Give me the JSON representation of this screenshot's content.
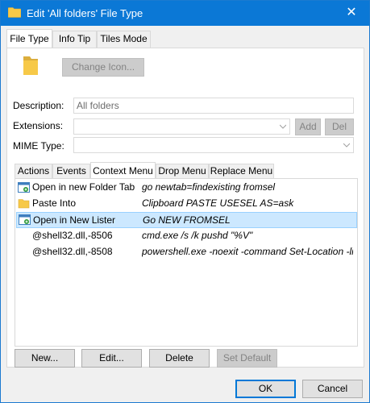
{
  "window": {
    "title": "Edit 'All folders' File Type",
    "close_glyph": "✕"
  },
  "tabs": [
    {
      "label": "File Type",
      "active": true
    },
    {
      "label": "Info Tip",
      "active": false
    },
    {
      "label": "Tiles Mode",
      "active": false
    }
  ],
  "file_type": {
    "change_icon_label": "Change Icon...",
    "description_label": "Description:",
    "description_value": "All folders",
    "extensions_label": "Extensions:",
    "extensions_value": "",
    "add_label": "Add",
    "del_label": "Del",
    "mime_label": "MIME Type:",
    "mime_value": ""
  },
  "inner_tabs": [
    {
      "label": "Actions",
      "active": false
    },
    {
      "label": "Events",
      "active": false
    },
    {
      "label": "Context Menu",
      "active": true
    },
    {
      "label": "Drop Menu",
      "active": false
    },
    {
      "label": "Replace Menu",
      "active": false
    }
  ],
  "context_menu_rows": [
    {
      "name": "Open in new Folder Tab",
      "command": "go newtab=findexisting fromsel",
      "icon": "folder-tab-icon",
      "selected": false
    },
    {
      "name": "Paste Into",
      "command": "Clipboard PASTE USESEL AS=ask",
      "icon": "folder-icon",
      "selected": false
    },
    {
      "name": "Open in New Lister",
      "command": "Go NEW FROMSEL",
      "icon": "new-lister-icon",
      "selected": true
    },
    {
      "name": "@shell32.dll,-8506",
      "command": "cmd.exe /s /k pushd \"%V\"",
      "icon": "",
      "selected": false
    },
    {
      "name": "@shell32.dll,-8508",
      "command": "powershell.exe -noexit -command Set-Location -lit...",
      "icon": "",
      "selected": false
    }
  ],
  "action_buttons": {
    "new_label": "New...",
    "edit_label": "Edit...",
    "delete_label": "Delete",
    "set_default_label": "Set Default"
  },
  "footer": {
    "ok_label": "OK",
    "cancel_label": "Cancel"
  },
  "colors": {
    "titlebar": "#0b78d6",
    "selection": "#cce8ff",
    "folder": "#f7c948"
  }
}
